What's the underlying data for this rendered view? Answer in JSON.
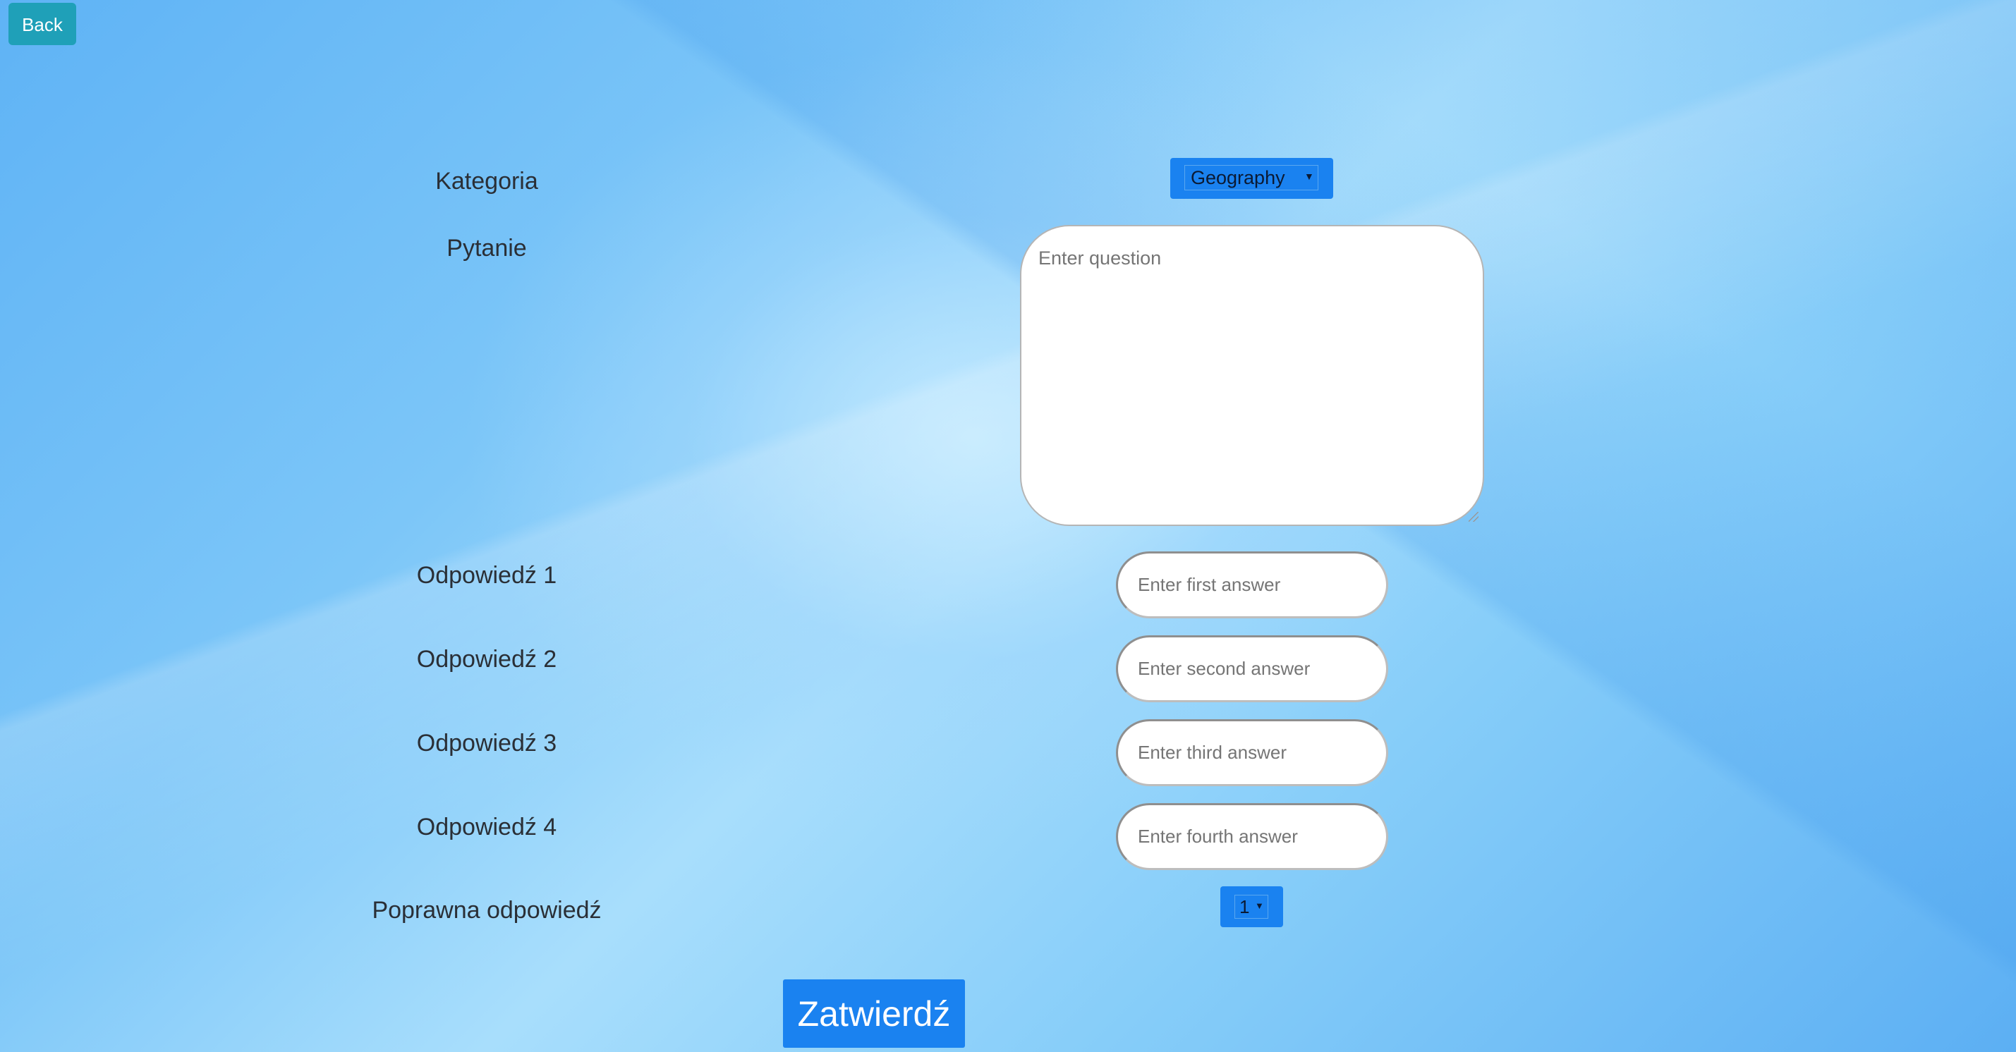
{
  "back_button": {
    "label": "Back"
  },
  "form": {
    "category": {
      "label": "Kategoria",
      "selected": "Geography",
      "caret": "▼"
    },
    "question": {
      "label": "Pytanie",
      "placeholder": "Enter question"
    },
    "answers": [
      {
        "label": "Odpowiedź 1",
        "placeholder": "Enter first answer"
      },
      {
        "label": "Odpowiedź 2",
        "placeholder": "Enter second answer"
      },
      {
        "label": "Odpowiedź 3",
        "placeholder": "Enter third answer"
      },
      {
        "label": "Odpowiedź 4",
        "placeholder": "Enter fourth answer"
      }
    ],
    "correct_answer": {
      "label": "Poprawna odpowiedź",
      "selected": "1",
      "caret": "▼"
    },
    "submit_label": "Zatwierdź"
  },
  "colors": {
    "back_button": "#1fa0b8",
    "accent": "#1a82f0",
    "label_text": "#2a2f36"
  }
}
